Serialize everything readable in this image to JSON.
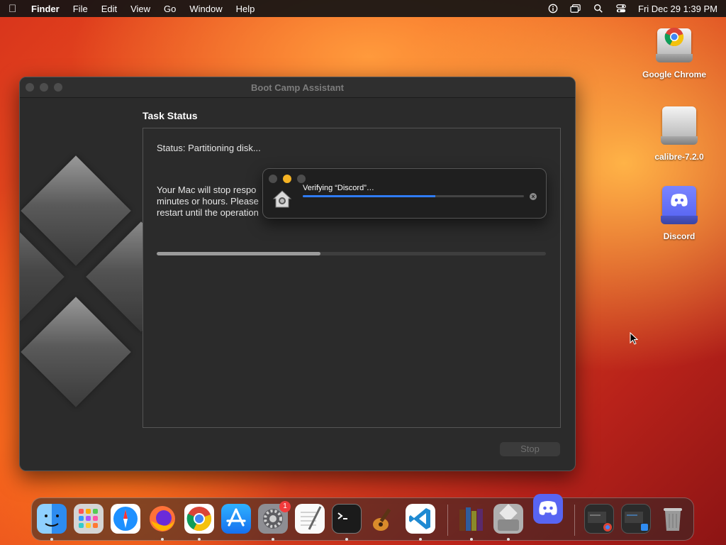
{
  "menubar": {
    "app": "Finder",
    "items": [
      "File",
      "Edit",
      "View",
      "Go",
      "Window",
      "Help"
    ],
    "clock": "Fri Dec 29  1:39 PM"
  },
  "desktop": {
    "icons": [
      {
        "label": "Google Chrome",
        "icon": "chrome-drive-icon"
      },
      {
        "label": "calibre-7.2.0",
        "icon": "drive-icon"
      },
      {
        "label": "Discord",
        "icon": "discord-drive-icon"
      }
    ]
  },
  "window": {
    "title": "Boot Camp Assistant",
    "task_title": "Task Status",
    "status": "Status: Partitioning disk...",
    "warning_lines": [
      "Your Mac will stop respo",
      "minutes or hours. Please",
      "restart until the operation"
    ],
    "progress": 0.42,
    "stop_label": "Stop"
  },
  "popup": {
    "label": "Verifying “Discord”…",
    "progress": 0.6
  },
  "dock": {
    "items": [
      "finder",
      "launchpad",
      "safari",
      "firefox",
      "chrome",
      "app-store",
      "system-settings",
      "textedit",
      "terminal",
      "garageband",
      "vscode",
      "calibre",
      "boot-camp-assistant",
      "discord",
      "window-1",
      "window-2",
      "trash"
    ],
    "settings_badge": "1"
  },
  "colors": {
    "accent_blue": "#2f7cf6",
    "popup_yellow": "#f5b324",
    "discord": "#5865f2"
  }
}
